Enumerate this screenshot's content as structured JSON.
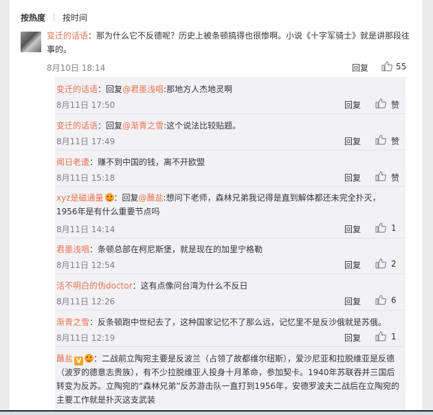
{
  "sort": {
    "hot": "按热度",
    "time": "按时间"
  },
  "main": {
    "user": "变迁的话语",
    "text": "：那为什么它不反德呢？历史上被条顿搞得也很惨啊。小说《十字军骑士》就是讲那段往事的。",
    "time": "8月10日 18:14",
    "reply_label": "回复",
    "likes": "55"
  },
  "replies": [
    {
      "user": "变迁的话语",
      "prefix": "：回复",
      "at": "@君墨浅唱",
      "text": ":那地方人杰地灵啊",
      "time": "8月11日 17:50",
      "reply_label": "回复",
      "likes": "赞"
    },
    {
      "user": "变迁的话语",
      "prefix": "：回复",
      "at": "@渐青之雪",
      "text": ":这个说法比较贴题。",
      "time": "8月11日 17:49",
      "reply_label": "回复",
      "likes": "赞"
    },
    {
      "user": "闻日老逶",
      "prefix": "",
      "at": "",
      "text": "：赚不到中国的钱，离不开欧盟",
      "time": "8月11日 15:18",
      "reply_label": "回复",
      "likes": "赞"
    },
    {
      "user": "xyz是磁通量",
      "prefix": "：回复",
      "at": "@蘸盐",
      "text": ":想问下老师，森林兄弟我记得是直到解体都还未完全扑灭，1956年是有什么重要节点吗",
      "time": "8月11日 14:14",
      "reply_label": "回复",
      "likes": "1"
    },
    {
      "user": "君墨浅唱",
      "prefix": "",
      "at": "",
      "text": "：条顿总部在柯尼斯堡，就是现在的加里宁格勒",
      "time": "8月11日 12:54",
      "reply_label": "回复",
      "likes": "2"
    },
    {
      "user": "活不明白的伪doctor",
      "prefix": "",
      "at": "",
      "text": "：这有点像问台湾为什么不反日",
      "time": "8月11日 12:26",
      "reply_label": "回复",
      "likes": "6"
    },
    {
      "user": "渐青之雪",
      "prefix": "",
      "at": "",
      "text": "：反条顿跑中世纪去了，这种国家记忆不了那么远，记忆里不是反沙俄就是苏俄。",
      "time": "8月11日 12:19",
      "reply_label": "回复",
      "likes": "1"
    },
    {
      "user": "蘸盐",
      "prefix": "",
      "at": "",
      "text": "：二战前立陶宛主要是反波兰（占领了故都维尔纽斯），爱沙尼亚和拉脱维亚是反德（波罗的德意志贵族），有不少拉脱维亚人投身十月革命，参加契卡。1940年苏联吞并三国后转变为反苏。立陶宛的“森林兄弟”反苏游击队一直打到1956年，安德罗波夫二战后在立陶宛的主要工作就是扑灭这支武装",
      "time": "",
      "reply_label": "",
      "likes": ""
    }
  ],
  "badge_v": "V"
}
